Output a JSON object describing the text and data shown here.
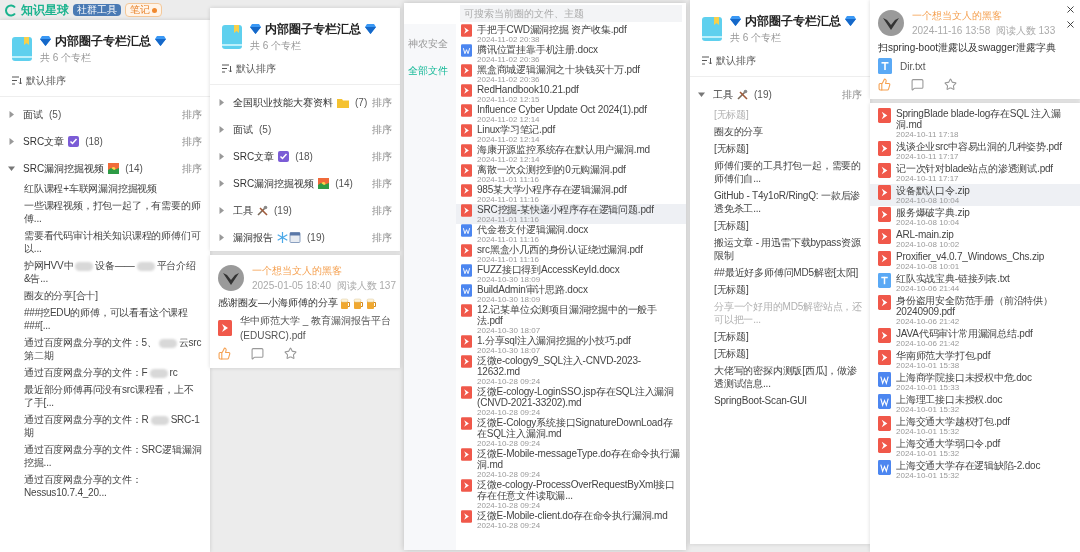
{
  "top_bar": {
    "brand": "知识星球",
    "badges": [
      {
        "label": "社群工具",
        "kind": "tool"
      },
      {
        "label": "笔记",
        "kind": "note"
      }
    ]
  },
  "left_panel": {
    "header": {
      "title": "内部圈子专栏汇总",
      "subtitle": "共 6 个专栏",
      "sort": "默认排序"
    },
    "categories": [
      {
        "label": "面试",
        "kind": "none",
        "count": "(5)",
        "action": "排序",
        "expanded": false
      },
      {
        "label": "SRC文章",
        "kind": "check",
        "count": "(18)",
        "action": "排序",
        "expanded": false
      },
      {
        "label": "SRC漏洞挖掘视频",
        "kind": "sunrise",
        "count": "(14)",
        "action": "排序",
        "expanded": true,
        "children": [
          {
            "parts": [
              "红队课程+车联网漏洞挖掘视频"
            ],
            "dimmed": false
          },
          {
            "parts": [
              "一些课程视频，打包一起了，有需要的师傅..."
            ],
            "dimmed": false
          },
          {
            "parts": [
              "需要看代码审计相关知识课程的师傅们可以..."
            ],
            "dimmed": false
          },
          {
            "parts": [
              "护网HVV中",
              "设备——",
              "平台介绍&告..."
            ],
            "dimmed": false
          },
          {
            "parts": [
              "圈友的分享[合十]"
            ],
            "dimmed": false
          },
          {
            "parts": [
              "###挖EDU的师傅，可以看看这个课程###[..."
            ],
            "dimmed": false
          },
          {
            "parts": [
              "通过百度网盘分享的文件：5、",
              "云src第二期"
            ],
            "dimmed": false
          },
          {
            "parts": [
              "通过百度网盘分享的文件：F",
              "rc"
            ],
            "dimmed": false
          },
          {
            "parts": [
              "最近部分师傅再问没有src课程看，上不了手[..."
            ],
            "dimmed": false
          },
          {
            "parts": [
              "通过百度网盘分享的文件：R",
              "SRC-1期"
            ],
            "dimmed": false
          },
          {
            "parts": [
              "通过百度网盘分享的文件：SRC逻辑漏洞挖掘..."
            ],
            "dimmed": false
          },
          {
            "parts": [
              "通过百度网盘分享的文件：Nessus10.7.4_20..."
            ],
            "dimmed": false
          }
        ]
      }
    ]
  },
  "middle_panel": {
    "header": {
      "title": "内部圈子专栏汇总",
      "subtitle": "共 6 个专栏",
      "sort": "默认排序"
    },
    "categories": [
      {
        "label": "全国职业技能大赛资料",
        "kind": "folder",
        "count": "(7)",
        "action": "排序",
        "expanded": false
      },
      {
        "label": "面试",
        "kind": "none",
        "count": "(5)",
        "action": "排序",
        "expanded": false
      },
      {
        "label": "SRC文章",
        "kind": "check",
        "count": "(18)",
        "action": "排序",
        "expanded": false
      },
      {
        "label": "SRC漏洞挖掘视频",
        "kind": "sunrise",
        "count": "(14)",
        "action": "排序",
        "expanded": false
      },
      {
        "label": "工具",
        "kind": "tools",
        "count": "(19)",
        "action": "排序",
        "expanded": false
      },
      {
        "label": "漏洞报告",
        "kind": "snow-calendar",
        "count": "(19)",
        "action": "排序",
        "expanded": false
      }
    ],
    "post": {
      "author": "一个想当文人的黑客",
      "meta": "2025-01-05 18:40  阅读人数 137",
      "text": "感谢圈友—小海师傅的分享",
      "reaction": true,
      "file": {
        "name": "华中师范大学 _ 教育漏洞报告平台(EDUSRC).pdf",
        "kind": "pdf"
      },
      "liked": true
    }
  },
  "file_dialog": {
    "search_placeholder": "可搜索当前圈的文件、主题",
    "sidebar": [
      {
        "label": "神农安全",
        "selected": false
      },
      {
        "label": "全部文件",
        "selected": true
      }
    ],
    "files": [
      {
        "name": "手把手CWD漏洞挖掘 资产收集.pdf",
        "date": "2024-11-02 20:38",
        "kind": "pdf",
        "hovered": false
      },
      {
        "name": "腾讯位置挂靠手机注册.docx",
        "date": "2024-11-02 20:36",
        "kind": "word",
        "hovered": false
      },
      {
        "name": "黑盒商城逻辑漏洞之十块钱买十万.pdf",
        "date": "2024-11-02 20:36",
        "kind": "pdf",
        "hovered": false
      },
      {
        "name": "RedHandbook10.21.pdf",
        "date": "2024-11-02 12:15",
        "kind": "pdf",
        "hovered": false
      },
      {
        "name": "Influence Cyber Update Oct 2024(1).pdf",
        "date": "2024-11-02 12:14",
        "kind": "pdf",
        "hovered": false
      },
      {
        "name": "Linux学习笔记.pdf",
        "date": "2024-11-02 12:14",
        "kind": "pdf",
        "hovered": false
      },
      {
        "name": "海康开源监控系统存在默认用户漏洞.md",
        "date": "2024-11-02 12:14",
        "kind": "pdf",
        "hovered": false
      },
      {
        "name": "离散一次众测挖到的0元购漏洞.pdf",
        "date": "2024-11-01 11:16",
        "kind": "pdf",
        "hovered": false
      },
      {
        "name": "985某大学小程序存在逻辑漏洞.pdf",
        "date": "2024-11-01 11:16",
        "kind": "pdf",
        "hovered": false
      },
      {
        "name": "SRC挖掘-某快递小程序存在逻辑问题.pdf",
        "date": "2024-11-01 11:16",
        "kind": "pdf",
        "hovered": true
      },
      {
        "name": "代金卷支付逻辑漏洞.docx",
        "date": "2024-11-01 11:16",
        "kind": "word",
        "hovered": false
      },
      {
        "name": "src黑盒小几西的身份认证绕过漏洞.pdf",
        "date": "2024-11-01 11:16",
        "kind": "pdf",
        "hovered": false
      },
      {
        "name": "FUZZ接口得到AccessKeyId.docx",
        "date": "2024-10-30 18:09",
        "kind": "word",
        "hovered": false
      },
      {
        "name": "BuildAdmin审计思路.docx",
        "date": "2024-10-30 18:09",
        "kind": "word",
        "hovered": false
      },
      {
        "name": "12.记某单位众测项目漏洞挖掘中的一般手法.pdf",
        "date": "2024-10-30 18:07",
        "kind": "pdf",
        "hovered": false
      },
      {
        "name": "1.分享sql注入漏洞挖掘的小技巧.pdf",
        "date": "2024-10-30 18:07",
        "kind": "pdf",
        "hovered": false
      },
      {
        "name": "泛微e-cology9_SQL注入-CNVD-2023-12632.md",
        "date": "2024-10-28 09:24",
        "kind": "pdf",
        "hovered": false
      },
      {
        "name": "泛微E-cology-LoginSSO.jsp存在SQL注入漏洞(CNVD-2021-33202).md",
        "date": "2024-10-28 09:24",
        "kind": "pdf",
        "hovered": false
      },
      {
        "name": "泛微E-Cology系统接口SignatureDownLoad存在SQL注入漏洞.md",
        "date": "2024-10-28 09:24",
        "kind": "pdf",
        "hovered": false
      },
      {
        "name": "泛微E-Mobile-messageType.do存在命令执行漏洞.md",
        "date": "2024-10-28 09:24",
        "kind": "pdf",
        "hovered": false
      },
      {
        "name": "泛微e-cology-ProcessOverRequestByXml接口存在任意文件读取漏...",
        "date": "2024-10-28 09:24",
        "kind": "pdf",
        "hovered": false
      },
      {
        "name": "泛微E-Mobile-client.do存在命令执行漏洞.md",
        "date": "2024-10-28 09:24",
        "kind": "pdf",
        "hovered": false
      }
    ]
  },
  "right_panel": {
    "header": {
      "title": "内部圈子专栏汇总",
      "subtitle": "共 6 个专栏",
      "sort": "默认排序"
    },
    "categories": [
      {
        "label": "工具",
        "kind": "tools",
        "count": "(19)",
        "action": "排序",
        "expanded": true,
        "children": [
          {
            "parts": [
              "[无标题]"
            ],
            "dimmed": true
          },
          {
            "parts": [
              "圈友的分享"
            ],
            "dimmed": false
          },
          {
            "parts": [
              "[无标题]"
            ],
            "dimmed": false
          },
          {
            "parts": [
              "师傅们要的工具打包一起，需要的师傅们自..."
            ],
            "dimmed": false
          },
          {
            "parts": [
              "GitHub - T4y1oR/RingQ: 一款后渗透免杀工..."
            ],
            "dimmed": false
          },
          {
            "parts": [
              "[无标题]"
            ],
            "dimmed": false
          },
          {
            "parts": [
              "搬运文章 - 用迅雷下载bypass资源限制"
            ],
            "dimmed": false
          },
          {
            "parts": [
              "##最近好多师傅问MD5解密[太阳]"
            ],
            "dimmed": false
          },
          {
            "parts": [
              "[无标题]"
            ],
            "dimmed": false
          },
          {
            "parts": [
              "分享一个好用的MD5解密站点，还可以把一..."
            ],
            "dimmed": true
          },
          {
            "parts": [
              "[无标题]"
            ],
            "dimmed": false
          },
          {
            "parts": [
              "[无标题]"
            ],
            "dimmed": false
          },
          {
            "parts": [
              "大佬写的密探内测版[西瓜]，做渗透测试信息..."
            ],
            "dimmed": false
          },
          {
            "parts": [
              "SpringBoot-Scan-GUI"
            ],
            "dimmed": false
          }
        ]
      }
    ]
  },
  "right_post": {
    "author": "一个想当文人的黑客",
    "meta": "2024-11-16 13:58  阅读人数 133",
    "text": "扫spring-boot泄露以及swagger泄露字典",
    "reaction": false,
    "file": {
      "name": "Dir.txt",
      "kind": "txt"
    },
    "liked": true
  },
  "right_files": [
    {
      "name": "SpringBlade blade-log存在SQL 注入漏洞.md",
      "date": "2024-10-11 17:18",
      "kind": "pdf",
      "hovered": false
    },
    {
      "name": "浅谈企业src中容易出洞的几种姿势.pdf",
      "date": "2024-10-11 17:17",
      "kind": "pdf",
      "hovered": false
    },
    {
      "name": "记一次针对blade站点的渗透测试.pdf",
      "date": "2024-10-11 17:17",
      "kind": "pdf",
      "hovered": false
    },
    {
      "name": "设备默认口令.zip",
      "date": "2024-10-08 10:04",
      "kind": "pdf",
      "hovered": true
    },
    {
      "name": "服务爆破字典.zip",
      "date": "2024-10-08 10:04",
      "kind": "pdf",
      "hovered": false
    },
    {
      "name": "ARL-main.zip",
      "date": "2024-10-08 10:02",
      "kind": "pdf",
      "hovered": false
    },
    {
      "name": "Proxifier_v4.0.7_Windows_Chs.zip",
      "date": "2024-10-08 10:01",
      "kind": "pdf",
      "hovered": false
    },
    {
      "name": "红队实战宝典-链接列表.txt",
      "date": "2024-10-06 21:44",
      "kind": "txt",
      "hovered": false
    },
    {
      "name": "身份盗用安全防范手册（前沿特供）20240909.pdf",
      "date": "2024-10-06 21:42",
      "kind": "pdf",
      "hovered": false
    },
    {
      "name": "JAVA代码审计常用漏洞总结.pdf",
      "date": "2024-10-06 21:42",
      "kind": "pdf",
      "hovered": false
    },
    {
      "name": "华南师范大学打包.pdf",
      "date": "2024-10-01 15:38",
      "kind": "pdf",
      "hovered": false
    },
    {
      "name": "上海商学院接口未授权中危.doc",
      "date": "2024-10-01 15:33",
      "kind": "word",
      "hovered": false
    },
    {
      "name": "上海理工接口未授权.doc",
      "date": "2024-10-01 15:32",
      "kind": "word",
      "hovered": false
    },
    {
      "name": "上海交通大学越权打包.pdf",
      "date": "2024-10-01 15:32",
      "kind": "pdf",
      "hovered": false
    },
    {
      "name": "上海交通大学弱口令.pdf",
      "date": "2024-10-01 15:32",
      "kind": "pdf",
      "hovered": false
    },
    {
      "name": "上海交通大学存在逻辑缺陷-2.doc",
      "date": "2024-10-01 15:32",
      "kind": "word",
      "hovered": false
    }
  ]
}
